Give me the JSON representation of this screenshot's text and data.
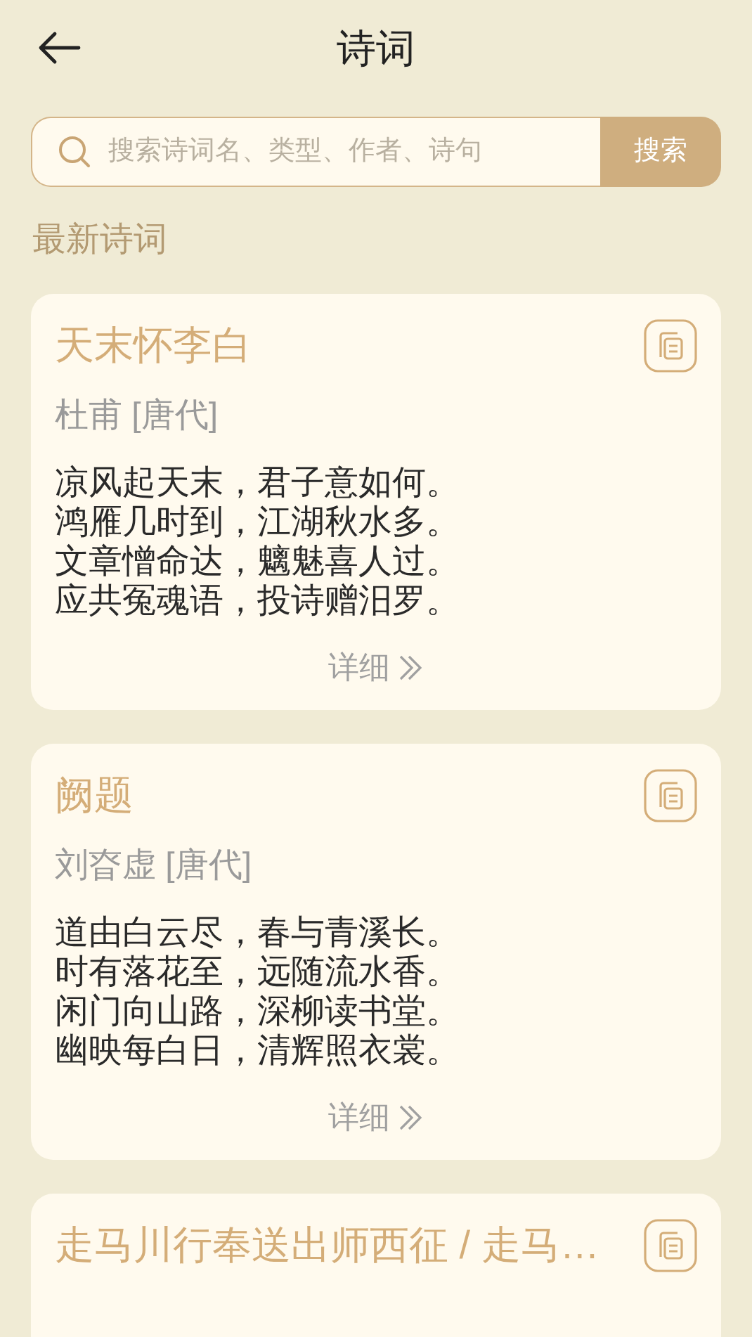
{
  "header": {
    "title": "诗词"
  },
  "search": {
    "placeholder": "搜索诗词名、类型、作者、诗句",
    "button": "搜索"
  },
  "section_title": "最新诗词",
  "poems": [
    {
      "title": "天末怀李白",
      "author": "杜甫 [唐代]",
      "lines": [
        "凉风起天末，君子意如何。",
        "鸿雁几时到，江湖秋水多。",
        "文章憎命达，魑魅喜人过。",
        "应共冤魂语，投诗赠汨罗。"
      ],
      "more": "详细"
    },
    {
      "title": "阙题",
      "author": "刘昚虚 [唐代]",
      "lines": [
        "道由白云尽，春与青溪长。",
        "时有落花至，远随流水香。",
        "闲门向山路，深柳读书堂。",
        "幽映每白日，清辉照衣裳。"
      ],
      "more": "详细"
    },
    {
      "title": "走马川行奉送出师西征 / 走马…"
    }
  ]
}
